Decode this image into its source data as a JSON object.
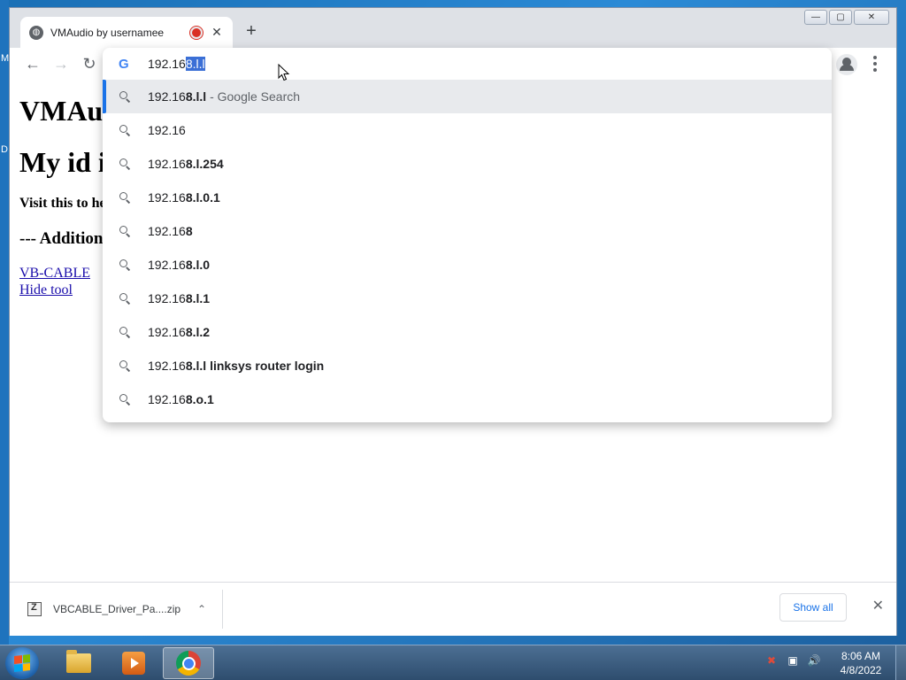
{
  "desktop": {
    "left_letters": [
      "M",
      "D"
    ]
  },
  "window": {
    "tab_title": "VMAudio by usernamee",
    "tab_close": "✕",
    "new_tab": "+",
    "controls": {
      "minimize": "—",
      "maximize": "▢",
      "close": "✕"
    }
  },
  "toolbar": {
    "back": "←",
    "forward": "→",
    "reload": "↻"
  },
  "omnibox": {
    "typed": "192.16",
    "autocompleted": "8.l.l",
    "suggestions": [
      {
        "plain": "192.16",
        "bold": "8.l.l",
        "suffix": " - Google Search",
        "active": true
      },
      {
        "plain": "192.16",
        "bold": "",
        "suffix": "",
        "active": false
      },
      {
        "plain": "192.16",
        "bold": "8.l.254",
        "suffix": "",
        "active": false
      },
      {
        "plain": "192.16",
        "bold": "8.l.0.1",
        "suffix": "",
        "active": false
      },
      {
        "plain": "192.16",
        "bold": "8",
        "suffix": "",
        "active": false
      },
      {
        "plain": "192.16",
        "bold": "8.l.0",
        "suffix": "",
        "active": false
      },
      {
        "plain": "192.16",
        "bold": "8.l.1",
        "suffix": "",
        "active": false
      },
      {
        "plain": "192.16",
        "bold": "8.l.2",
        "suffix": "",
        "active": false
      },
      {
        "plain": "192.16",
        "bold": "8.l.l linksys router login",
        "suffix": "",
        "active": false
      },
      {
        "plain": "192.16",
        "bold": "8.o.1",
        "suffix": "",
        "active": false
      }
    ]
  },
  "page": {
    "heading1": "VMAu",
    "heading2": "My id i",
    "visit": "Visit this to he",
    "heading3": "--- Addition",
    "links": [
      "VB-CABLE",
      "Hide tool"
    ]
  },
  "downloads": {
    "file_name": "VBCABLE_Driver_Pa....zip",
    "chevron": "⌃",
    "show_all": "Show all",
    "close": "✕"
  },
  "taskbar": {
    "time": "8:06 AM",
    "date": "4/8/2022",
    "tray": [
      "✖",
      "▣",
      "🔊"
    ]
  }
}
